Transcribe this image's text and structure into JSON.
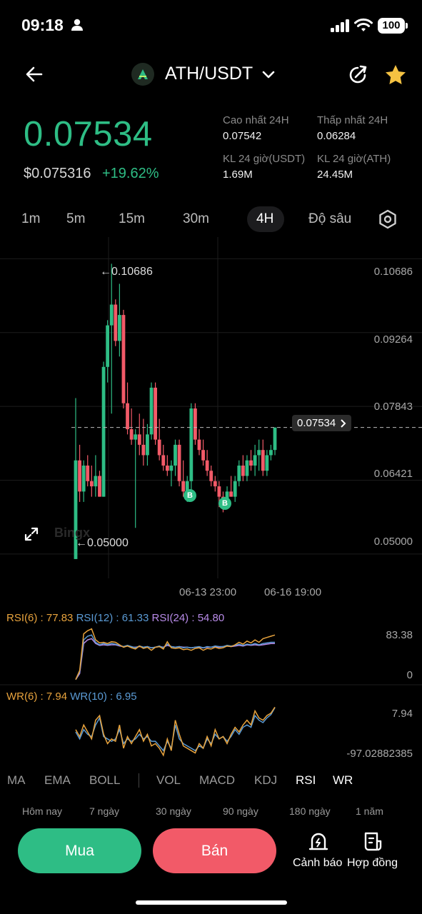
{
  "status": {
    "time": "09:18",
    "battery": "100"
  },
  "header": {
    "pair": "ATH/USDT"
  },
  "ticker": {
    "last_price": "0.07534",
    "usd_price": "$0.075316",
    "change": "+19.62%",
    "high_label": "Cao nhất 24H",
    "high_value": "0.07542",
    "low_label": "Thấp nhất 24H",
    "low_value": "0.06284",
    "vol_usdt_label": "KL 24 giờ(USDT)",
    "vol_usdt_value": "1.69M",
    "vol_ath_label": "KL 24 giờ(ATH)",
    "vol_ath_value": "24.45M"
  },
  "timeframes": [
    "1m",
    "5m",
    "15m",
    "30m",
    "4H",
    "Độ sâu"
  ],
  "active_timeframe": "4H",
  "colors": {
    "up": "#2ebd85",
    "down": "#f25a68",
    "rsi6": "#e8a33d",
    "rsi12": "#5b9bd5",
    "rsi24": "#b88be8"
  },
  "chart_data": {
    "type": "candlestick",
    "y_ticks": [
      "0.10686",
      "0.09264",
      "0.07843",
      "0.06421",
      "0.05000"
    ],
    "ylim": [
      0.046,
      0.112
    ],
    "current_price_tag": "0.07534",
    "max_marker": "0.10686",
    "min_marker": "0.05000",
    "x_ticks": [
      "06-13 23:00",
      "06-16 19:00"
    ],
    "watermark": "Bingx",
    "buy_markers": [
      "B",
      "B"
    ],
    "candles": [
      {
        "o": 0.05,
        "h": 0.081,
        "l": 0.05,
        "c": 0.069
      },
      {
        "o": 0.069,
        "h": 0.072,
        "l": 0.061,
        "c": 0.063
      },
      {
        "o": 0.063,
        "h": 0.069,
        "l": 0.061,
        "c": 0.068
      },
      {
        "o": 0.068,
        "h": 0.07,
        "l": 0.064,
        "c": 0.065
      },
      {
        "o": 0.065,
        "h": 0.068,
        "l": 0.062,
        "c": 0.064
      },
      {
        "o": 0.064,
        "h": 0.07,
        "l": 0.062,
        "c": 0.066
      },
      {
        "o": 0.066,
        "h": 0.067,
        "l": 0.062,
        "c": 0.062
      },
      {
        "o": 0.062,
        "h": 0.088,
        "l": 0.062,
        "c": 0.087
      },
      {
        "o": 0.087,
        "h": 0.096,
        "l": 0.084,
        "c": 0.095
      },
      {
        "o": 0.095,
        "h": 0.10686,
        "l": 0.078,
        "c": 0.099
      },
      {
        "o": 0.099,
        "h": 0.1,
        "l": 0.091,
        "c": 0.092
      },
      {
        "o": 0.092,
        "h": 0.103,
        "l": 0.089,
        "c": 0.097
      },
      {
        "o": 0.097,
        "h": 0.098,
        "l": 0.079,
        "c": 0.08
      },
      {
        "o": 0.08,
        "h": 0.084,
        "l": 0.074,
        "c": 0.075
      },
      {
        "o": 0.075,
        "h": 0.079,
        "l": 0.072,
        "c": 0.073
      },
      {
        "o": 0.073,
        "h": 0.075,
        "l": 0.056,
        "c": 0.074
      },
      {
        "o": 0.074,
        "h": 0.078,
        "l": 0.07,
        "c": 0.072
      },
      {
        "o": 0.072,
        "h": 0.077,
        "l": 0.068,
        "c": 0.07
      },
      {
        "o": 0.07,
        "h": 0.076,
        "l": 0.068,
        "c": 0.074
      },
      {
        "o": 0.074,
        "h": 0.084,
        "l": 0.073,
        "c": 0.083
      },
      {
        "o": 0.083,
        "h": 0.084,
        "l": 0.072,
        "c": 0.073
      },
      {
        "o": 0.073,
        "h": 0.077,
        "l": 0.069,
        "c": 0.07
      },
      {
        "o": 0.07,
        "h": 0.072,
        "l": 0.067,
        "c": 0.068
      },
      {
        "o": 0.068,
        "h": 0.07,
        "l": 0.066,
        "c": 0.067
      },
      {
        "o": 0.067,
        "h": 0.069,
        "l": 0.064,
        "c": 0.068
      },
      {
        "o": 0.068,
        "h": 0.073,
        "l": 0.066,
        "c": 0.072
      },
      {
        "o": 0.072,
        "h": 0.073,
        "l": 0.064,
        "c": 0.065
      },
      {
        "o": 0.065,
        "h": 0.069,
        "l": 0.062,
        "c": 0.063
      },
      {
        "o": 0.063,
        "h": 0.066,
        "l": 0.061,
        "c": 0.065
      },
      {
        "o": 0.065,
        "h": 0.08,
        "l": 0.063,
        "c": 0.079
      },
      {
        "o": 0.079,
        "h": 0.08,
        "l": 0.072,
        "c": 0.073
      },
      {
        "o": 0.073,
        "h": 0.075,
        "l": 0.07,
        "c": 0.071
      },
      {
        "o": 0.071,
        "h": 0.073,
        "l": 0.068,
        "c": 0.069
      },
      {
        "o": 0.069,
        "h": 0.071,
        "l": 0.066,
        "c": 0.067
      },
      {
        "o": 0.067,
        "h": 0.068,
        "l": 0.064,
        "c": 0.065
      },
      {
        "o": 0.065,
        "h": 0.066,
        "l": 0.063,
        "c": 0.064
      },
      {
        "o": 0.064,
        "h": 0.065,
        "l": 0.06,
        "c": 0.062
      },
      {
        "o": 0.062,
        "h": 0.063,
        "l": 0.059,
        "c": 0.061
      },
      {
        "o": 0.061,
        "h": 0.064,
        "l": 0.06,
        "c": 0.063
      },
      {
        "o": 0.063,
        "h": 0.066,
        "l": 0.062,
        "c": 0.062
      },
      {
        "o": 0.062,
        "h": 0.066,
        "l": 0.061,
        "c": 0.065
      },
      {
        "o": 0.065,
        "h": 0.069,
        "l": 0.064,
        "c": 0.068
      },
      {
        "o": 0.068,
        "h": 0.07,
        "l": 0.065,
        "c": 0.066
      },
      {
        "o": 0.066,
        "h": 0.07,
        "l": 0.065,
        "c": 0.069
      },
      {
        "o": 0.069,
        "h": 0.071,
        "l": 0.067,
        "c": 0.068
      },
      {
        "o": 0.068,
        "h": 0.072,
        "l": 0.066,
        "c": 0.07
      },
      {
        "o": 0.07,
        "h": 0.073,
        "l": 0.067,
        "c": 0.071
      },
      {
        "o": 0.071,
        "h": 0.073,
        "l": 0.066,
        "c": 0.067
      },
      {
        "o": 0.067,
        "h": 0.071,
        "l": 0.066,
        "c": 0.07
      },
      {
        "o": 0.07,
        "h": 0.072,
        "l": 0.069,
        "c": 0.071
      },
      {
        "o": 0.071,
        "h": 0.075,
        "l": 0.07,
        "c": 0.07534
      }
    ],
    "rsi": {
      "label6": "RSI(6)",
      "value6": "77.83",
      "label12": "RSI(12)",
      "value12": "61.33",
      "label24": "RSI(24)",
      "value24": "54.80",
      "y_top": "83.38",
      "y_bottom": "0",
      "rsi6": [
        5,
        20,
        80,
        85,
        88,
        70,
        65,
        66,
        64,
        67,
        66,
        62,
        58,
        60,
        57,
        55,
        60,
        56,
        58,
        53,
        58,
        59,
        55,
        67,
        57,
        56,
        57,
        54,
        55,
        53,
        56,
        57,
        53,
        56,
        55,
        58,
        56,
        57,
        60,
        59,
        62,
        66,
        63,
        68,
        65,
        70,
        66,
        72,
        74,
        76,
        78
      ],
      "rsi12": [
        5,
        18,
        70,
        76,
        78,
        66,
        62,
        64,
        62,
        64,
        63,
        61,
        59,
        61,
        59,
        57,
        60,
        58,
        59,
        57,
        58,
        60,
        57,
        63,
        59,
        58,
        59,
        57,
        58,
        57,
        58,
        59,
        57,
        59,
        58,
        60,
        59,
        59,
        61,
        60,
        61,
        63,
        61,
        63,
        62,
        64,
        62,
        64,
        65,
        66,
        66
      ],
      "rsi24": [
        5,
        15,
        64,
        70,
        72,
        64,
        61,
        62,
        61,
        62,
        62,
        60,
        59,
        60,
        58,
        58,
        59,
        58,
        59,
        57,
        58,
        59,
        58,
        61,
        59,
        58,
        59,
        58,
        58,
        57,
        58,
        58,
        57,
        58,
        58,
        59,
        58,
        59,
        60,
        59,
        60,
        61,
        60,
        62,
        61,
        62,
        61,
        62,
        63,
        64,
        64
      ]
    },
    "wr": {
      "label6": "WR(6)",
      "value6": "7.94",
      "label10": "WR(10)",
      "value10": "6.95",
      "y_top": "7.94",
      "y_bottom": "-97.02882385",
      "wr6": [
        -40,
        -55,
        -30,
        -45,
        -60,
        -20,
        -10,
        -50,
        -70,
        -60,
        -65,
        -30,
        -80,
        -55,
        -70,
        -55,
        -40,
        -65,
        -50,
        -75,
        -70,
        -80,
        -95,
        -60,
        -85,
        -20,
        -50,
        -75,
        -80,
        -85,
        -90,
        -70,
        -80,
        -55,
        -75,
        -40,
        -60,
        -55,
        -70,
        -50,
        -35,
        -45,
        -30,
        -20,
        -30,
        0,
        -15,
        -20,
        -10,
        -5,
        8
      ],
      "wr10": [
        -45,
        -60,
        -40,
        -50,
        -55,
        -30,
        -15,
        -55,
        -60,
        -65,
        -60,
        -40,
        -70,
        -60,
        -65,
        -60,
        -50,
        -60,
        -55,
        -65,
        -65,
        -75,
        -85,
        -65,
        -80,
        -30,
        -60,
        -70,
        -75,
        -80,
        -85,
        -75,
        -80,
        -60,
        -70,
        -50,
        -60,
        -55,
        -65,
        -55,
        -40,
        -50,
        -35,
        -30,
        -35,
        -10,
        -20,
        -25,
        -15,
        -8,
        7
      ]
    }
  },
  "indicator_tabs": [
    "MA",
    "EMA",
    "BOLL",
    "VOL",
    "MACD",
    "KDJ",
    "RSI",
    "WR"
  ],
  "active_indicators": [
    "RSI",
    "WR"
  ],
  "range_tabs": [
    "Hôm nay",
    "7 ngày",
    "30 ngày",
    "90 ngày",
    "180 ngày",
    "1 năm"
  ],
  "actions": {
    "buy": "Mua",
    "sell": "Bán",
    "alert": "Cảnh báo",
    "contract": "Hợp đồng"
  }
}
